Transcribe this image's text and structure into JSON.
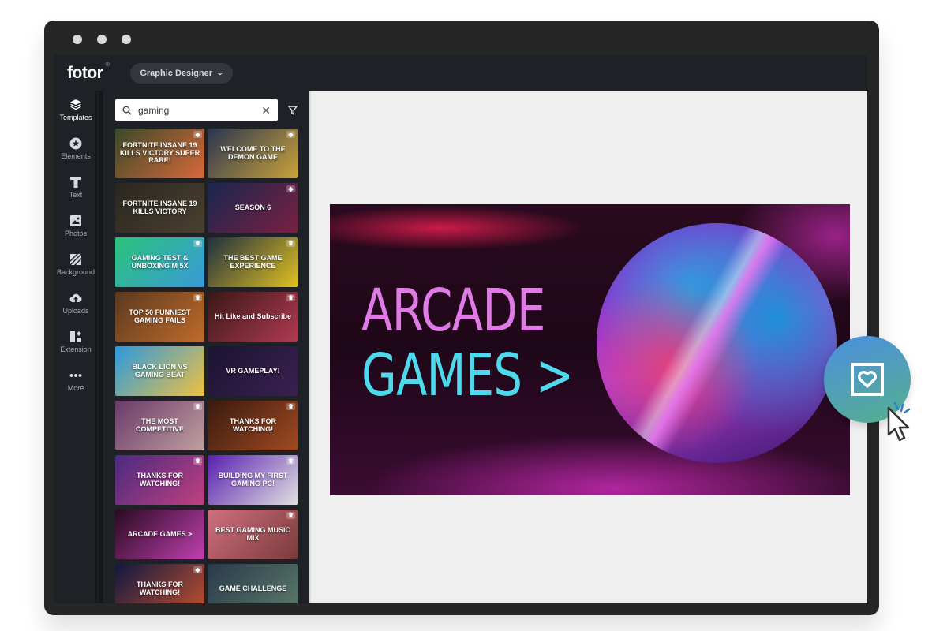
{
  "window": {
    "traffic_lights": [
      "close",
      "minimize",
      "maximize"
    ]
  },
  "topbar": {
    "logo": "fotor",
    "logo_mark": "®",
    "mode_label": "Graphic Designer",
    "mode_icon": "chevron-down-icon"
  },
  "sidebar": {
    "items": [
      {
        "label": "Templates",
        "icon": "layers-icon",
        "active": true
      },
      {
        "label": "Elements",
        "icon": "star-circle-icon",
        "active": false
      },
      {
        "label": "Text",
        "icon": "text-icon",
        "active": false
      },
      {
        "label": "Photos",
        "icon": "photo-icon",
        "active": false
      },
      {
        "label": "Background",
        "icon": "stripes-icon",
        "active": false
      },
      {
        "label": "Uploads",
        "icon": "cloud-upload-icon",
        "active": false
      },
      {
        "label": "Extension",
        "icon": "apps-icon",
        "active": false
      },
      {
        "label": "More",
        "icon": "more-dots-icon",
        "active": false
      }
    ]
  },
  "panel": {
    "search": {
      "value": "gaming",
      "placeholder": "",
      "search_icon": "search-icon",
      "clear_icon": "close-icon"
    },
    "filter_icon": "filter-icon",
    "templates": [
      {
        "title": "FORTNITE INSANE 19 KILLS VICTORY SUPER RARE!",
        "badge": "diamond",
        "colors": [
          "#3a4a2a",
          "#d9683a"
        ]
      },
      {
        "title": "WELCOME TO THE DEMON GAME",
        "badge": "diamond",
        "colors": [
          "#2a3550",
          "#caa23a"
        ]
      },
      {
        "title": "FORTNITE INSANE 19 KILLS VICTORY",
        "badge": "",
        "colors": [
          "#2a2620",
          "#4a4030"
        ]
      },
      {
        "title": "SEASON 6",
        "badge": "diamond",
        "colors": [
          "#1a2650",
          "#7a2040"
        ]
      },
      {
        "title": "GAMING TEST & UNBOXING M 5X",
        "badge": "crown",
        "colors": [
          "#2ac37a",
          "#3a9ad8"
        ]
      },
      {
        "title": "THE BEST GAME EXPERIENCE",
        "badge": "crown",
        "colors": [
          "#203040",
          "#e0c020"
        ]
      },
      {
        "title": "TOP 50 FUNNIEST GAMING FAILS",
        "badge": "crown",
        "colors": [
          "#5a3a20",
          "#c06a2a"
        ]
      },
      {
        "title": "Hit Like and Subscribe",
        "badge": "crown",
        "colors": [
          "#3a1818",
          "#b03a50"
        ]
      },
      {
        "title": "BLACK LION VS GAMING BEAT",
        "badge": "",
        "colors": [
          "#2a9ae0",
          "#f0c040"
        ]
      },
      {
        "title": "VR GAMEPLAY!",
        "badge": "",
        "colors": [
          "#1a1430",
          "#3a2050"
        ]
      },
      {
        "title": "THE MOST COMPETITIVE",
        "badge": "crown",
        "colors": [
          "#6a3a6a",
          "#c0a0a0"
        ]
      },
      {
        "title": "THANKS FOR WATCHING!",
        "badge": "crown",
        "colors": [
          "#3a1a10",
          "#a04a20"
        ]
      },
      {
        "title": "THANKS FOR WATCHING!",
        "badge": "crown",
        "colors": [
          "#4a2a80",
          "#c04080"
        ]
      },
      {
        "title": "BUILDING MY FIRST GAMING PC!",
        "badge": "crown",
        "colors": [
          "#5a20b0",
          "#e0e0e0"
        ]
      },
      {
        "title": "ARCADE GAMES >",
        "badge": "",
        "colors": [
          "#2a0a20",
          "#c040b0"
        ]
      },
      {
        "title": "BEST GAMING MUSIC MIX",
        "badge": "crown",
        "colors": [
          "#d07080",
          "#7a3a3a"
        ]
      },
      {
        "title": "THANKS FOR WATCHING!",
        "badge": "diamond",
        "colors": [
          "#101840",
          "#c05030"
        ]
      },
      {
        "title": "GAME CHALLENGE",
        "badge": "",
        "colors": [
          "#2a3a4a",
          "#5a7a6a"
        ]
      }
    ]
  },
  "canvas": {
    "design": {
      "line1": "ARCADE",
      "line2": "GAMES",
      "arrow": ">",
      "line1_color": "#e07ae6",
      "line2_color": "#4fd9ec"
    }
  },
  "floating_action": {
    "icon": "favorite-image-icon",
    "cursor_icon": "pointer-cursor-icon"
  }
}
